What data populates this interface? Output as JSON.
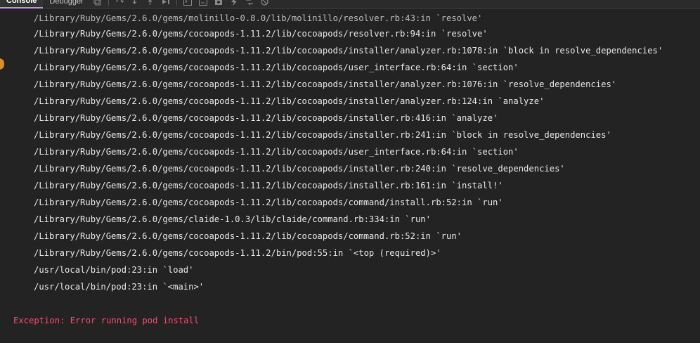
{
  "toolbar": {
    "tabs": [
      {
        "label": "Console",
        "active": true
      },
      {
        "label": "Debugger",
        "active": false
      }
    ],
    "icons": [
      "copy-icon",
      "step-over-icon",
      "step-into-icon",
      "step-out-icon",
      "resume-icon",
      "terminal-icon",
      "terminal-alt-icon",
      "screenshot-icon",
      "flash-icon",
      "network-icon",
      "disable-icon"
    ],
    "accent_color": "#c98bf0"
  },
  "console": {
    "partial_top_line": "/Library/Ruby/Gems/2.6.0/gems/molinillo-0.8.0/lib/molinillo/resolver.rb:43:in `resolve'",
    "lines": [
      "/Library/Ruby/Gems/2.6.0/gems/cocoapods-1.11.2/lib/cocoapods/resolver.rb:94:in `resolve'",
      "/Library/Ruby/Gems/2.6.0/gems/cocoapods-1.11.2/lib/cocoapods/installer/analyzer.rb:1078:in `block in resolve_dependencies'",
      "/Library/Ruby/Gems/2.6.0/gems/cocoapods-1.11.2/lib/cocoapods/user_interface.rb:64:in `section'",
      "/Library/Ruby/Gems/2.6.0/gems/cocoapods-1.11.2/lib/cocoapods/installer/analyzer.rb:1076:in `resolve_dependencies'",
      "/Library/Ruby/Gems/2.6.0/gems/cocoapods-1.11.2/lib/cocoapods/installer/analyzer.rb:124:in `analyze'",
      "/Library/Ruby/Gems/2.6.0/gems/cocoapods-1.11.2/lib/cocoapods/installer.rb:416:in `analyze'",
      "/Library/Ruby/Gems/2.6.0/gems/cocoapods-1.11.2/lib/cocoapods/installer.rb:241:in `block in resolve_dependencies'",
      "/Library/Ruby/Gems/2.6.0/gems/cocoapods-1.11.2/lib/cocoapods/user_interface.rb:64:in `section'",
      "/Library/Ruby/Gems/2.6.0/gems/cocoapods-1.11.2/lib/cocoapods/installer.rb:240:in `resolve_dependencies'",
      "/Library/Ruby/Gems/2.6.0/gems/cocoapods-1.11.2/lib/cocoapods/installer.rb:161:in `install!'",
      "/Library/Ruby/Gems/2.6.0/gems/cocoapods-1.11.2/lib/cocoapods/command/install.rb:52:in `run'",
      "/Library/Ruby/Gems/2.6.0/gems/claide-1.0.3/lib/claide/command.rb:334:in `run'",
      "/Library/Ruby/Gems/2.6.0/gems/cocoapods-1.11.2/lib/cocoapods/command.rb:52:in `run'",
      "/Library/Ruby/Gems/2.6.0/gems/cocoapods-1.11.2/bin/pod:55:in `<top (required)>'",
      "/usr/local/bin/pod:23:in `load'",
      "/usr/local/bin/pod:23:in `<main>'"
    ],
    "exception": "Exception: Error running pod install",
    "text_color": "#e8e8e8",
    "error_color": "#f0506e",
    "background": "#232323"
  }
}
